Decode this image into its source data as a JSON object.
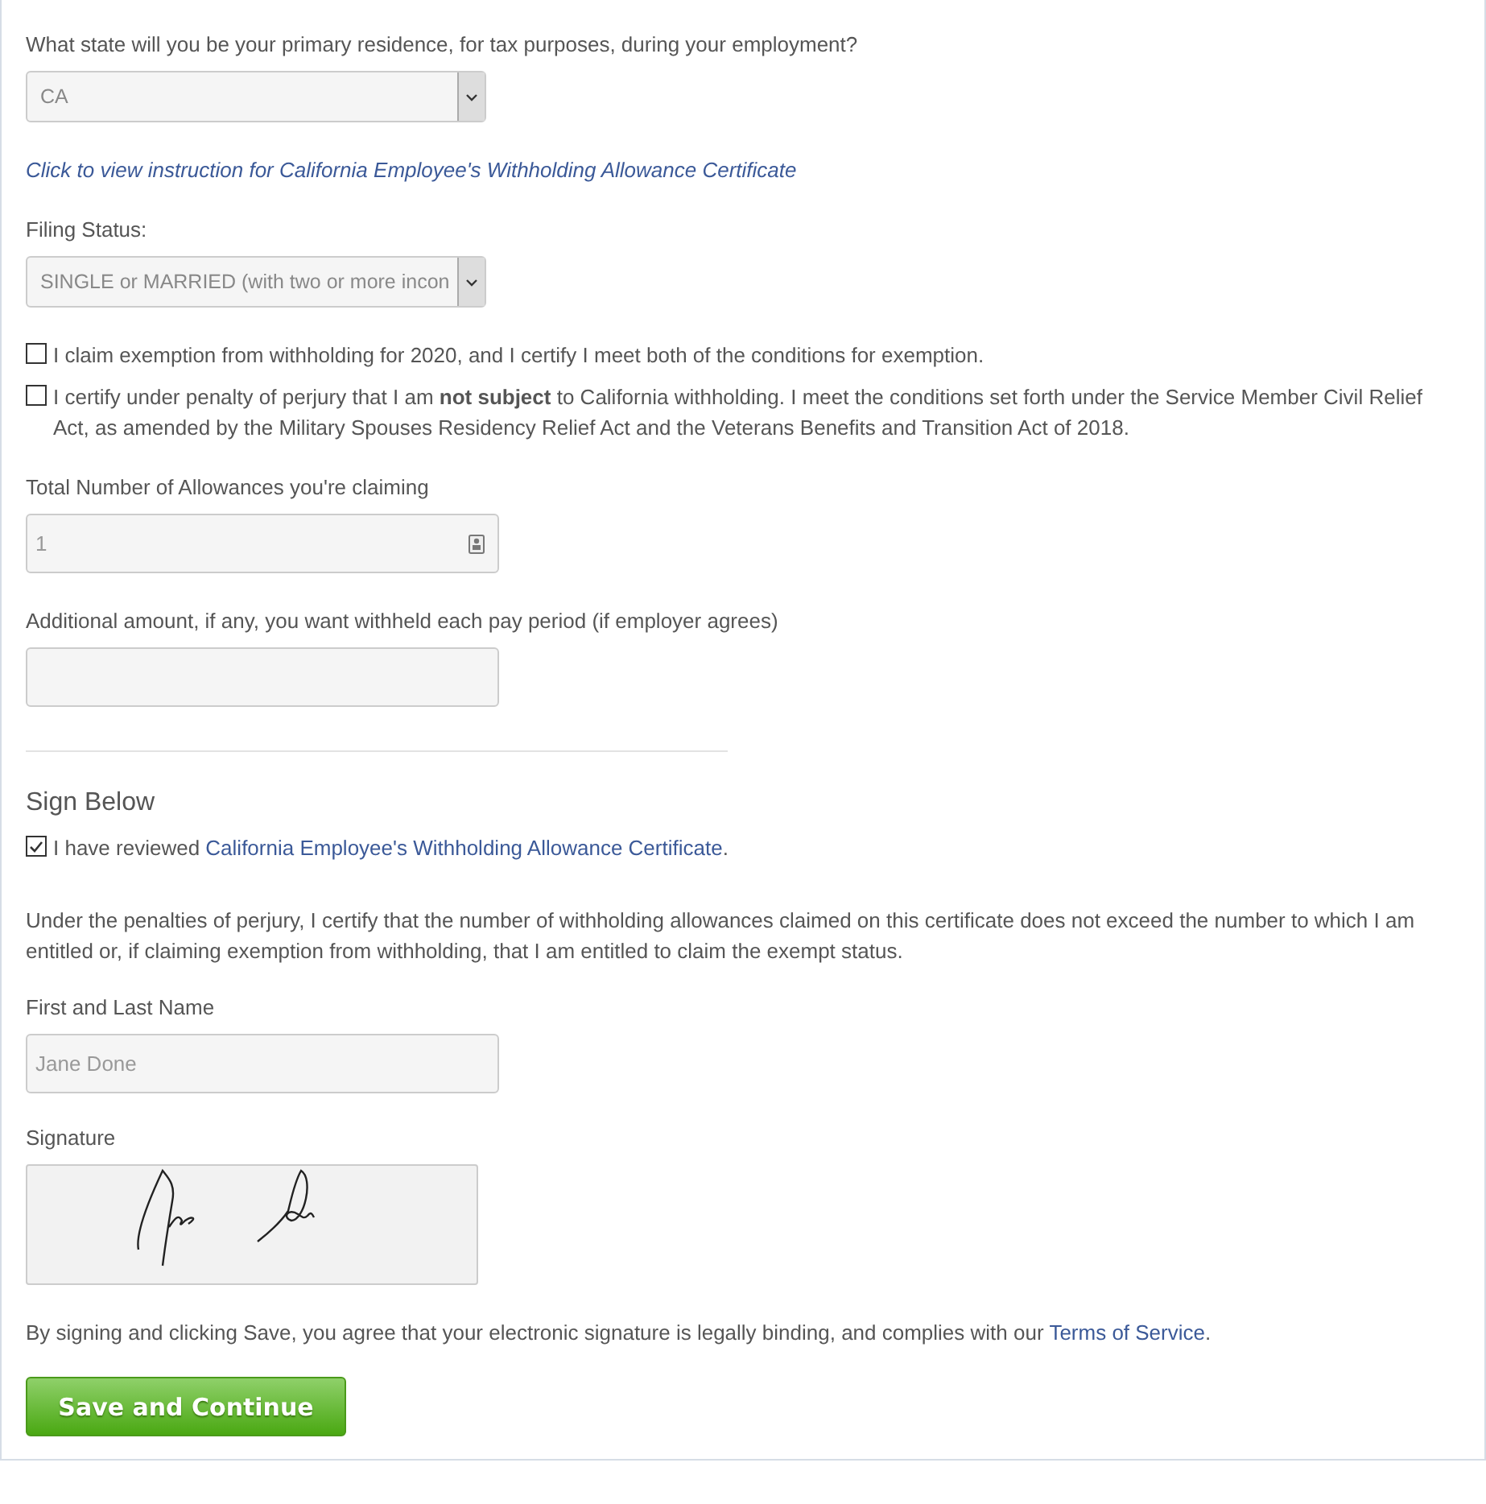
{
  "state_question": {
    "label": "What state will you be your primary residence, for tax purposes, during your employment?",
    "value": "CA"
  },
  "instruction_link": "Click to view instruction for California Employee's Withholding Allowance Certificate",
  "filing_status": {
    "label": "Filing Status:",
    "value": "SINGLE or MARRIED (with two or more incon"
  },
  "exemptions": [
    {
      "text": "I claim exemption from withholding for 2020, and I certify I meet both of the conditions for exemption.",
      "checked": false
    },
    {
      "text": "I certify under penalty of perjury that I am **not subject** to California withholding. I meet the conditions set forth under the Service Member Civil Relief Act, as amended by the Military Spouses Residency Relief Act and the Veterans Benefits and Transition Act of 2018.",
      "checked": false
    }
  ],
  "allowances": {
    "label": "Total Number of Allowances you're claiming",
    "value": "1"
  },
  "additional_amount": {
    "label": "Additional amount, if any, you want withheld each pay period (if employer agrees)"
  },
  "sign_section": {
    "heading": "Sign Below",
    "review": {
      "prefix": "I have reviewed ",
      "link": "California Employee's Withholding Allowance Certificate",
      "suffix": ".",
      "checked": true
    },
    "certification": "Under the penalties of perjury, I certify that the number of withholding allowances claimed on this certificate does not exceed the number to which I am entitled or, if claiming exemption from withholding, that I am entitled to claim the exempt status.",
    "name": {
      "label": "First and Last Name",
      "value": "Jane Done"
    },
    "signature_label": "Signature",
    "agreement": {
      "text": "By signing and clicking Save, you agree that your electronic signature is legally binding, and complies with our ",
      "link": "Terms of Service",
      "suffix": "."
    },
    "button": "Save and Continue"
  }
}
